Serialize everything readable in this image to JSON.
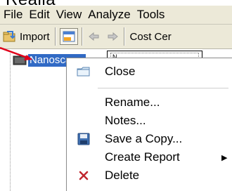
{
  "clipped_title": "Realia",
  "menubar": {
    "items": [
      "File",
      "Edit",
      "View",
      "Analyze",
      "Tools"
    ]
  },
  "toolbar": {
    "import_label": "Import",
    "cost_center_label": "Cost Cer"
  },
  "tree": {
    "selected_item_label": "Nanosca",
    "rename_value": "N"
  },
  "context_menu": {
    "close_label": "Close",
    "rename_label": "Rename...",
    "notes_label": "Notes...",
    "save_copy_label": "Save a Copy...",
    "create_report_label": "Create Report",
    "delete_label": "Delete"
  },
  "colors": {
    "selection": "#316ac5",
    "chrome": "#ece9d8",
    "pointer": "#e0001a",
    "delete_x": "#c0262e"
  },
  "icons": {
    "import": "import-icon",
    "folder": "folder-icon",
    "save": "floppy-disk-icon",
    "delete": "red-x-icon"
  }
}
